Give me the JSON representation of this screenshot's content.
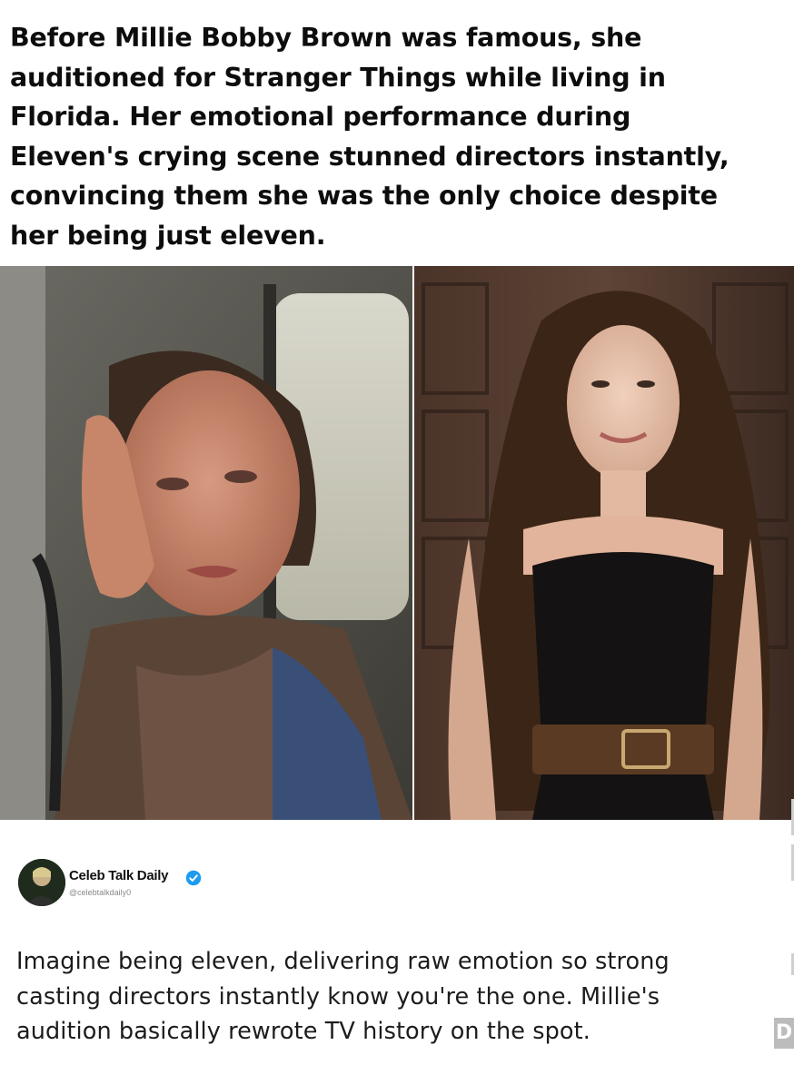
{
  "headline": "Before Millie Bobby Brown was famous, she\nauditioned for Stranger Things while living in\nFlorida. Her emotional performance during\nEleven's crying scene stunned directors instantly,\nconvincing them she was the only choice despite\nher being just eleven.",
  "images": {
    "left": "photo-crying-girl-in-vehicle",
    "right": "photo-smiling-woman-black-dress-belt"
  },
  "post": {
    "author_name": "Celeb Talk Daily",
    "author_handle": "@celebtalkdaily0",
    "verified": true,
    "verified_color": "#1d9bf0",
    "text": "Imagine being eleven, delivering raw emotion so strong\ncasting directors instantly know you're the one. Millie's\naudition basically rewrote TV history on the spot."
  },
  "corner_badge": "D"
}
